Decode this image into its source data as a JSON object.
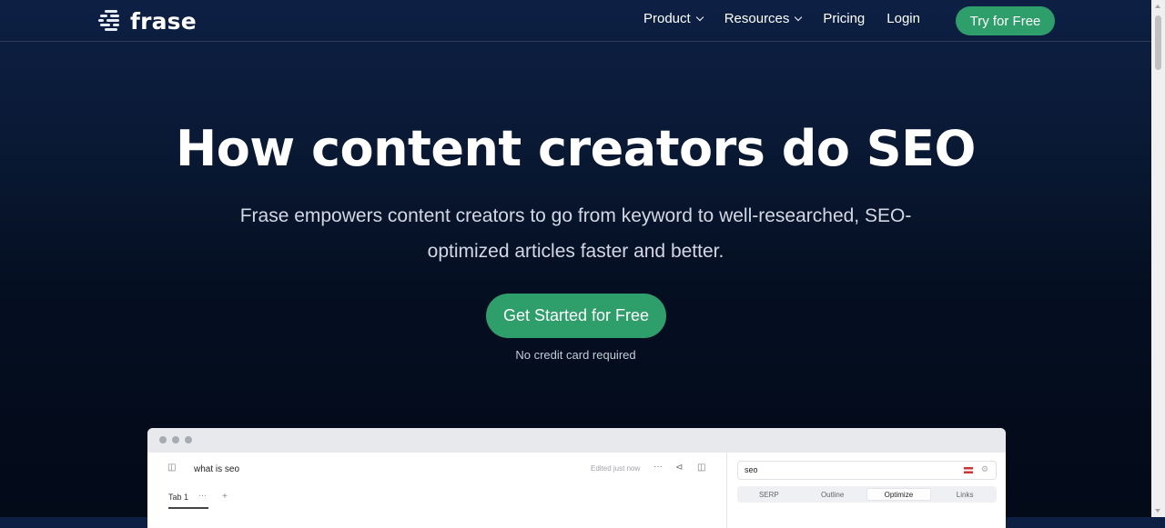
{
  "nav": {
    "logo_text": "frase",
    "items": [
      {
        "label": "Product",
        "dropdown": true
      },
      {
        "label": "Resources",
        "dropdown": true
      },
      {
        "label": "Pricing",
        "dropdown": false
      },
      {
        "label": "Login",
        "dropdown": false
      }
    ],
    "cta_label": "Try for Free"
  },
  "hero": {
    "title": "How content creators do SEO",
    "subtitle": "Frase empowers content creators to go from keyword to well-researched, SEO-optimized articles faster and better.",
    "cta_label": "Get Started for Free",
    "note": "No credit card required"
  },
  "app_preview": {
    "doc_title": "what is seo",
    "status": "Edited just now",
    "tab_label": "Tab 1",
    "search_value": "seo",
    "panel_tabs": [
      "SERP",
      "Outline",
      "Optimize",
      "Links"
    ],
    "active_panel_tab": "Optimize"
  },
  "colors": {
    "accent": "#2e9e6b",
    "background_top": "#0d2044",
    "background_bottom": "#030a18"
  },
  "icons": [
    "logo-icon",
    "chevron-down-icon",
    "sidebar-toggle-icon",
    "more-icon",
    "share-icon",
    "panel-toggle-icon",
    "add-tab-icon",
    "us-flag-icon",
    "settings-icon"
  ]
}
